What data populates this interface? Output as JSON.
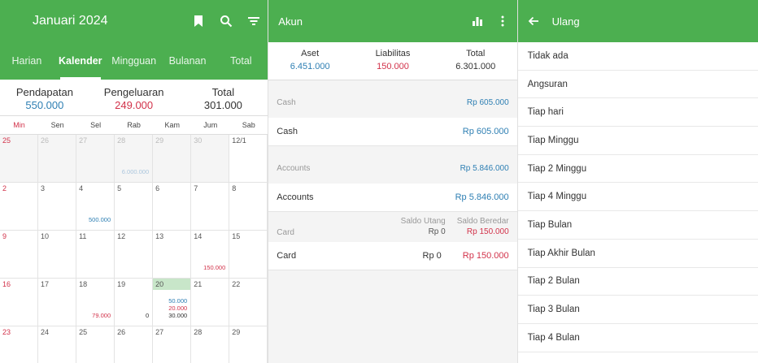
{
  "calendar": {
    "title": "Januari 2024",
    "tabs": [
      "Harian",
      "Kalender",
      "Mingguan",
      "Bulanan",
      "Total"
    ],
    "active_tab": 1,
    "summary": {
      "income_label": "Pendapatan",
      "income": "550.000",
      "expense_label": "Pengeluaran",
      "expense": "249.000",
      "total_label": "Total",
      "total": "301.000"
    },
    "weekdays": [
      "Min",
      "Sen",
      "Sel",
      "Rab",
      "Kam",
      "Jum",
      "Sab"
    ],
    "weeks": [
      [
        {
          "d": "25",
          "out": true
        },
        {
          "d": "26",
          "out": true
        },
        {
          "d": "27",
          "out": true
        },
        {
          "d": "28",
          "out": true,
          "a": [
            {
              "v": "6.000.000",
              "c": "dim"
            }
          ]
        },
        {
          "d": "29",
          "out": true
        },
        {
          "d": "30",
          "out": true
        },
        {
          "d": "12/1"
        }
      ],
      [
        {
          "d": "2"
        },
        {
          "d": "3"
        },
        {
          "d": "4",
          "a": [
            {
              "v": "500.000",
              "c": "blue"
            }
          ]
        },
        {
          "d": "5"
        },
        {
          "d": "6"
        },
        {
          "d": "7"
        },
        {
          "d": "8"
        }
      ],
      [
        {
          "d": "9"
        },
        {
          "d": "10"
        },
        {
          "d": "11"
        },
        {
          "d": "12"
        },
        {
          "d": "13"
        },
        {
          "d": "14",
          "a": [
            {
              "v": "150.000",
              "c": "red"
            }
          ]
        },
        {
          "d": "15"
        }
      ],
      [
        {
          "d": "16"
        },
        {
          "d": "17"
        },
        {
          "d": "18",
          "a": [
            {
              "v": "79.000",
              "c": "red"
            }
          ]
        },
        {
          "d": "19",
          "a": [
            {
              "v": "0",
              "c": "black"
            }
          ]
        },
        {
          "d": "20",
          "today": true,
          "a": [
            {
              "v": "50.000",
              "c": "blue"
            },
            {
              "v": "20.000",
              "c": "red"
            },
            {
              "v": "30.000",
              "c": "black"
            }
          ]
        },
        {
          "d": "21"
        },
        {
          "d": "22"
        }
      ],
      [
        {
          "d": "23"
        },
        {
          "d": "24"
        },
        {
          "d": "25"
        },
        {
          "d": "26"
        },
        {
          "d": "27"
        },
        {
          "d": "28"
        },
        {
          "d": "29"
        }
      ]
    ]
  },
  "accounts": {
    "title": "Akun",
    "totals": {
      "assets_label": "Aset",
      "assets": "6.451.000",
      "liabilities_label": "Liabilitas",
      "liabilities": "150.000",
      "total_label": "Total",
      "total": "6.301.000"
    },
    "cash": {
      "section": "Cash",
      "section_amount": "Rp 605.000",
      "name": "Cash",
      "amount": "Rp 605.000"
    },
    "accounts": {
      "section": "Accounts",
      "section_amount": "Rp 5.846.000",
      "name": "Accounts",
      "amount": "Rp 5.846.000"
    },
    "card": {
      "section": "Card",
      "col1_label": "Saldo Utang",
      "col1_value": "Rp 0",
      "col2_label": "Saldo Beredar",
      "col2_value": "Rp 150.000",
      "name": "Card",
      "balance": "Rp 0",
      "outstanding": "Rp 150.000"
    }
  },
  "repeat": {
    "title": "Ulang",
    "options": [
      "Tidak ada",
      "Angsuran",
      "Tiap hari",
      "Tiap Minggu",
      "Tiap 2 Minggu",
      "Tiap 4 Minggu",
      "Tiap Bulan",
      "Tiap Akhir Bulan",
      "Tiap 2 Bulan",
      "Tiap 3 Bulan",
      "Tiap 4 Bulan"
    ]
  },
  "colors": {
    "primary": "#4caf50",
    "income": "#2e7fb3",
    "expense": "#d2324a"
  },
  "icons": [
    "bookmark-icon",
    "search-icon",
    "filter-icon",
    "bar-chart-icon",
    "more-vert-icon",
    "back-arrow-icon"
  ]
}
